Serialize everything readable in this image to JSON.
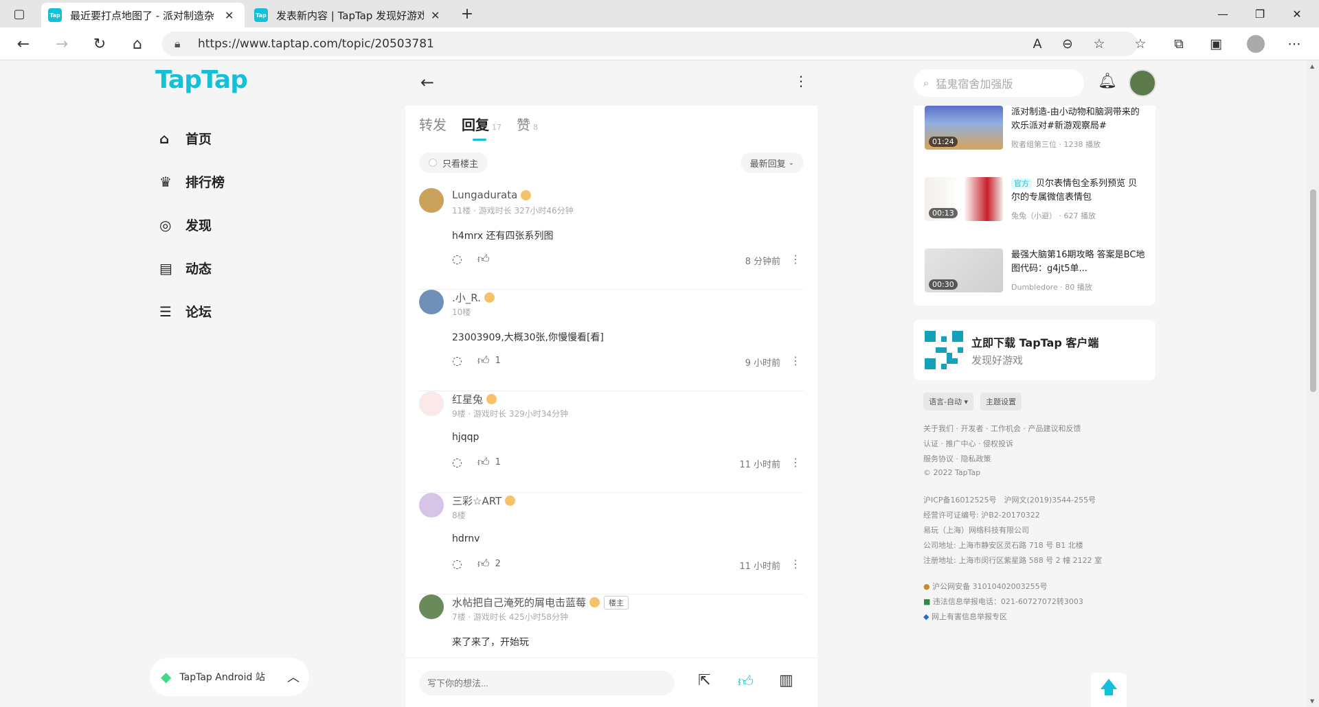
{
  "browser": {
    "tabs": [
      {
        "title": "最近要打点地图了 - 派对制造杂",
        "icon": "taptap-favicon"
      },
      {
        "title": "发表新内容 | TapTap 发现好游戏",
        "icon": "taptap-favicon"
      }
    ],
    "url": "https://www.taptap.com/topic/20503781",
    "favicon_text": "Tap"
  },
  "site": {
    "logo": "TapTap"
  },
  "leftnav": [
    {
      "label": "首页",
      "icon": "home-icon"
    },
    {
      "label": "排行榜",
      "icon": "trophy-icon"
    },
    {
      "label": "发现",
      "icon": "discover-icon"
    },
    {
      "label": "动态",
      "icon": "activity-icon"
    },
    {
      "label": "论坛",
      "icon": "forum-icon"
    }
  ],
  "android_bar": {
    "label": "TapTap Android 站"
  },
  "content": {
    "tabs": [
      {
        "label": "转发",
        "count": ""
      },
      {
        "label": "回复",
        "count": "17"
      },
      {
        "label": "赞",
        "count": "8"
      }
    ],
    "only_owner": "只看楼主",
    "sort": "最新回复",
    "comments": [
      {
        "user": "Lungadurata",
        "meta": "11楼 · 游戏时长 327小时46分钟",
        "text": "h4mrx 还有四张系列图",
        "likes": "",
        "time": "8 分钟前",
        "owner": ""
      },
      {
        "user": ".小_R.",
        "meta": "10楼",
        "text": "23003909,大概30张,你慢慢看[看]",
        "likes": "1",
        "time": "9 小时前",
        "owner": ""
      },
      {
        "user": "红星兔",
        "meta": "9楼 · 游戏时长 329小时34分钟",
        "text": "hjqqp",
        "likes": "1",
        "time": "11 小时前",
        "owner": ""
      },
      {
        "user": "三彩☆ART",
        "meta": "8楼",
        "text": "hdrnv",
        "likes": "2",
        "time": "11 小时前",
        "owner": ""
      },
      {
        "user": "水帖把自己淹死的屑电击蓝莓",
        "meta": "7楼 · 游戏时长 425小时58分钟",
        "text": "来了来了，开始玩",
        "likes": "",
        "time": "",
        "owner": "楼主"
      }
    ],
    "input_placeholder": "写下你的想法..."
  },
  "right": {
    "search_placeholder": "猛鬼宿舍加强版",
    "videos": [
      {
        "title": "派对制造-由小动物和脑洞带来的欢乐派对#新游观察局#",
        "official": "",
        "author": "败者组第三位",
        "plays": "1238 播放",
        "duration": "01:24"
      },
      {
        "title": "贝尔表情包全系列预览 贝尔的专属微信表情包",
        "official": "官方",
        "author": "兔兔（小避）",
        "plays": "627 播放",
        "duration": "00:13"
      },
      {
        "title": "最强大脑第16期攻略 答案是BC地图代码：g4jt5单...",
        "official": "",
        "author": "Dumbledore",
        "plays": "80 播放",
        "duration": "00:30"
      }
    ],
    "download": {
      "title": "立即下载 TapTap 客户端",
      "sub": "发现好游戏"
    },
    "lang_chip": "语言-自动",
    "theme_chip": "主题设置",
    "footer_links": [
      "关于我们 · 开发者 · 工作机会 · 产品建议和反馈",
      "认证 · 推广中心 · 侵权投诉",
      "服务协议 · 隐私政策",
      "© 2022 TapTap"
    ],
    "footer_legal": [
      "沪ICP备16012525号　沪网文(2019)3544-255号",
      "经营许可证编号: 沪B2-20170322",
      "易玩（上海）网络科技有限公司",
      "公司地址: 上海市静安区灵石路 718 号 B1 北楼",
      "注册地址: 上海市闵行区紫星路 588 号 2 幢 2122 室"
    ],
    "footer_badges": [
      "沪公网安备 31010402003255号",
      "违法信息举报电话：021-60727072转3003",
      "网上有害信息举报专区"
    ]
  },
  "colors": {
    "brand": "#14c0d8",
    "bg": "#f5f5f5"
  }
}
